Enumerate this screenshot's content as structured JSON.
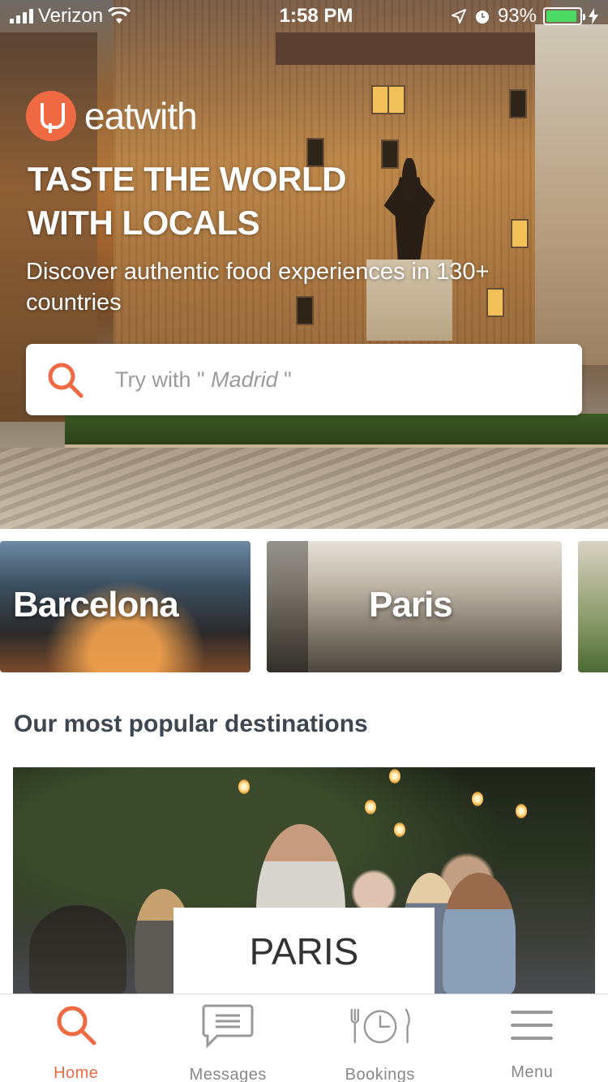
{
  "status_bar": {
    "carrier": "Verizon",
    "time": "1:58 PM",
    "battery": "93%",
    "battery_level": 0.93
  },
  "brand": {
    "name": "eatwith",
    "accent_color": "#ef6a42"
  },
  "hero": {
    "title": "TASTE THE WORLD WITH LOCALS",
    "subtitle": "Discover authentic food experiences in 130+ countries"
  },
  "search": {
    "prefix": "Try with \" ",
    "city": "Madrid",
    "suffix": " \""
  },
  "city_cards": [
    {
      "label": "Barcelona"
    },
    {
      "label": "Paris"
    },
    {
      "label": ""
    }
  ],
  "popular": {
    "heading": "Our most popular destinations",
    "featured_city": "PARIS"
  },
  "tabs": [
    {
      "label": "Home",
      "icon": "search-icon",
      "active": true
    },
    {
      "label": "Messages",
      "icon": "chat-icon",
      "active": false
    },
    {
      "label": "Bookings",
      "icon": "bookings-icon",
      "active": false
    },
    {
      "label": "Menu",
      "icon": "menu-icon",
      "active": false
    }
  ]
}
